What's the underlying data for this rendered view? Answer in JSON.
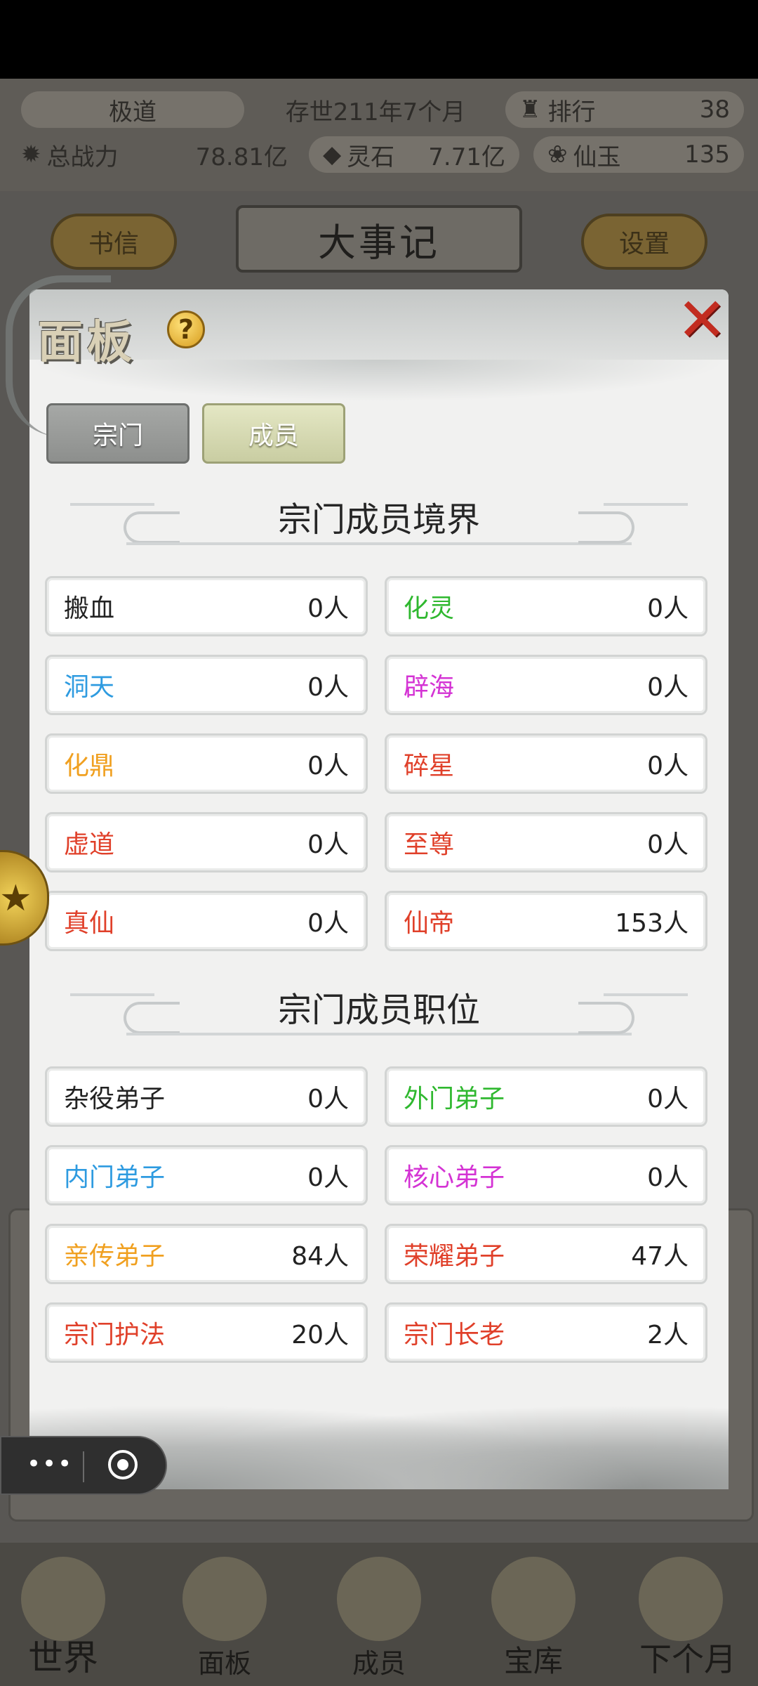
{
  "hud": {
    "realm": "极道",
    "age": "存世211年7个月",
    "rank_label": "排行",
    "rank_value": "38",
    "power_label": "总战力",
    "power_value": "78.81亿",
    "spirit_stone_label": "灵石",
    "spirit_stone_value": "7.71亿",
    "jade_label": "仙玉",
    "jade_value": "135"
  },
  "background_tabs": {
    "letters": "书信",
    "title": "大事记",
    "settings": "设置"
  },
  "modal": {
    "title": "面板",
    "help_glyph": "?",
    "close_glyph": "✕",
    "tabs": [
      "宗门",
      "成员"
    ],
    "active_tab": "成员",
    "realm_section_title": "宗门成员境界",
    "position_section_title": "宗门成员职位",
    "realms": [
      {
        "name": "搬血",
        "count": "0人",
        "color": "#222222"
      },
      {
        "name": "化灵",
        "count": "0人",
        "color": "#2fb82f"
      },
      {
        "name": "洞天",
        "count": "0人",
        "color": "#2e9be0"
      },
      {
        "name": "辟海",
        "count": "0人",
        "color": "#d433d4"
      },
      {
        "name": "化鼎",
        "count": "0人",
        "color": "#f0a020"
      },
      {
        "name": "碎星",
        "count": "0人",
        "color": "#e0402a"
      },
      {
        "name": "虚道",
        "count": "0人",
        "color": "#e0402a"
      },
      {
        "name": "至尊",
        "count": "0人",
        "color": "#e0402a"
      },
      {
        "name": "真仙",
        "count": "0人",
        "color": "#e0402a"
      },
      {
        "name": "仙帝",
        "count": "153人",
        "color": "#e0402a"
      }
    ],
    "positions": [
      {
        "name": "杂役弟子",
        "count": "0人",
        "color": "#222222"
      },
      {
        "name": "外门弟子",
        "count": "0人",
        "color": "#2fb82f"
      },
      {
        "name": "内门弟子",
        "count": "0人",
        "color": "#2e9be0"
      },
      {
        "name": "核心弟子",
        "count": "0人",
        "color": "#d433d4"
      },
      {
        "name": "亲传弟子",
        "count": "84人",
        "color": "#f0a020"
      },
      {
        "name": "荣耀弟子",
        "count": "47人",
        "color": "#e0402a"
      },
      {
        "name": "宗门护法",
        "count": "20人",
        "color": "#e0402a"
      },
      {
        "name": "宗门长老",
        "count": "2人",
        "color": "#e0402a"
      }
    ]
  },
  "bottom_nav": [
    "世界",
    "面板",
    "成员",
    "宝库",
    "下个月"
  ],
  "mini_program": {
    "dots": "•••"
  }
}
